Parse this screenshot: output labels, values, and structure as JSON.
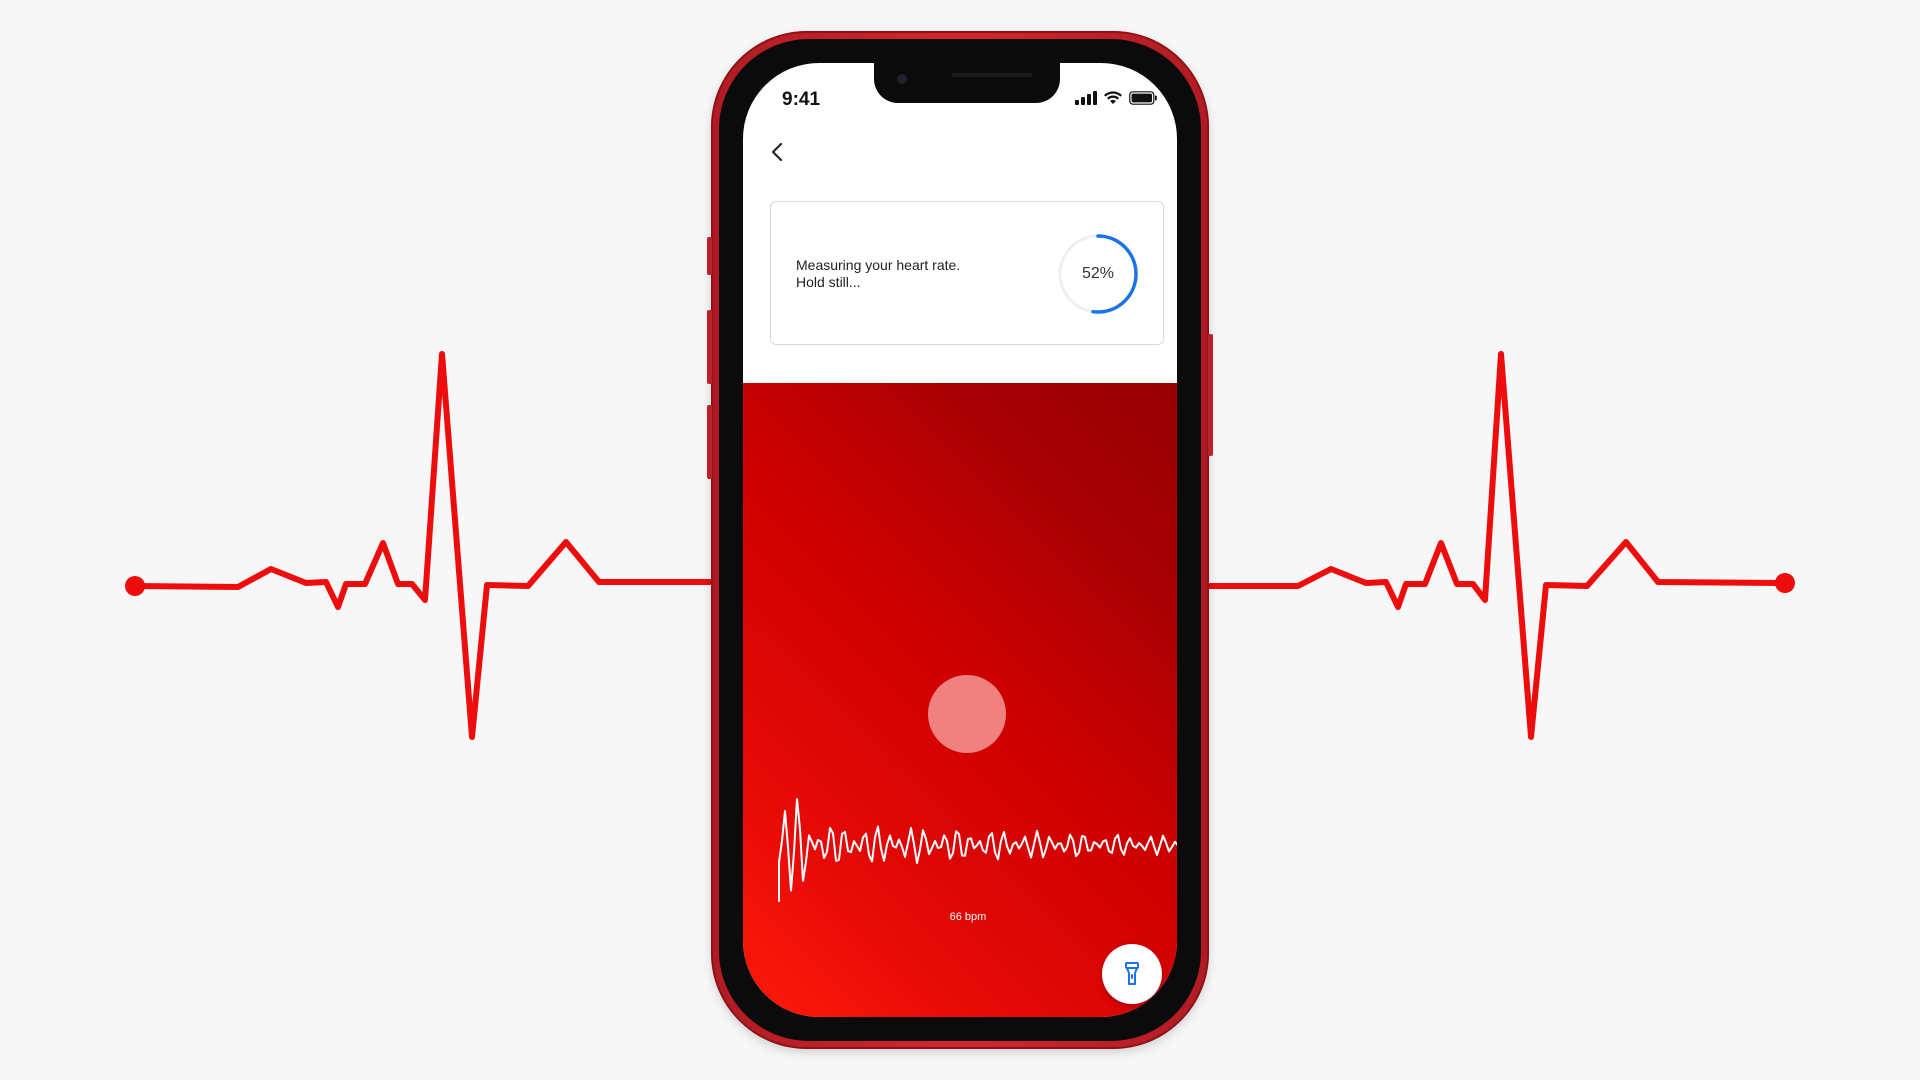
{
  "status_bar": {
    "time": "9:41"
  },
  "card": {
    "message_line1": "Measuring your heart rate.",
    "message_line2": "Hold still...",
    "progress_fraction": 0.52,
    "progress_label": "52%"
  },
  "measurement": {
    "bpm_label": "66 bpm"
  },
  "icons": {
    "back": "chevron-left-icon",
    "flash": "flashlight-icon",
    "signal": "cellular-signal-icon",
    "wifi": "wifi-icon",
    "battery": "battery-icon"
  },
  "colors": {
    "ecg_red": "#ee0d0d",
    "progress_blue": "#1a73e8",
    "phone_red": "#c9252b",
    "camera_red": "#d80404",
    "finger_dot": "#ef8181"
  }
}
